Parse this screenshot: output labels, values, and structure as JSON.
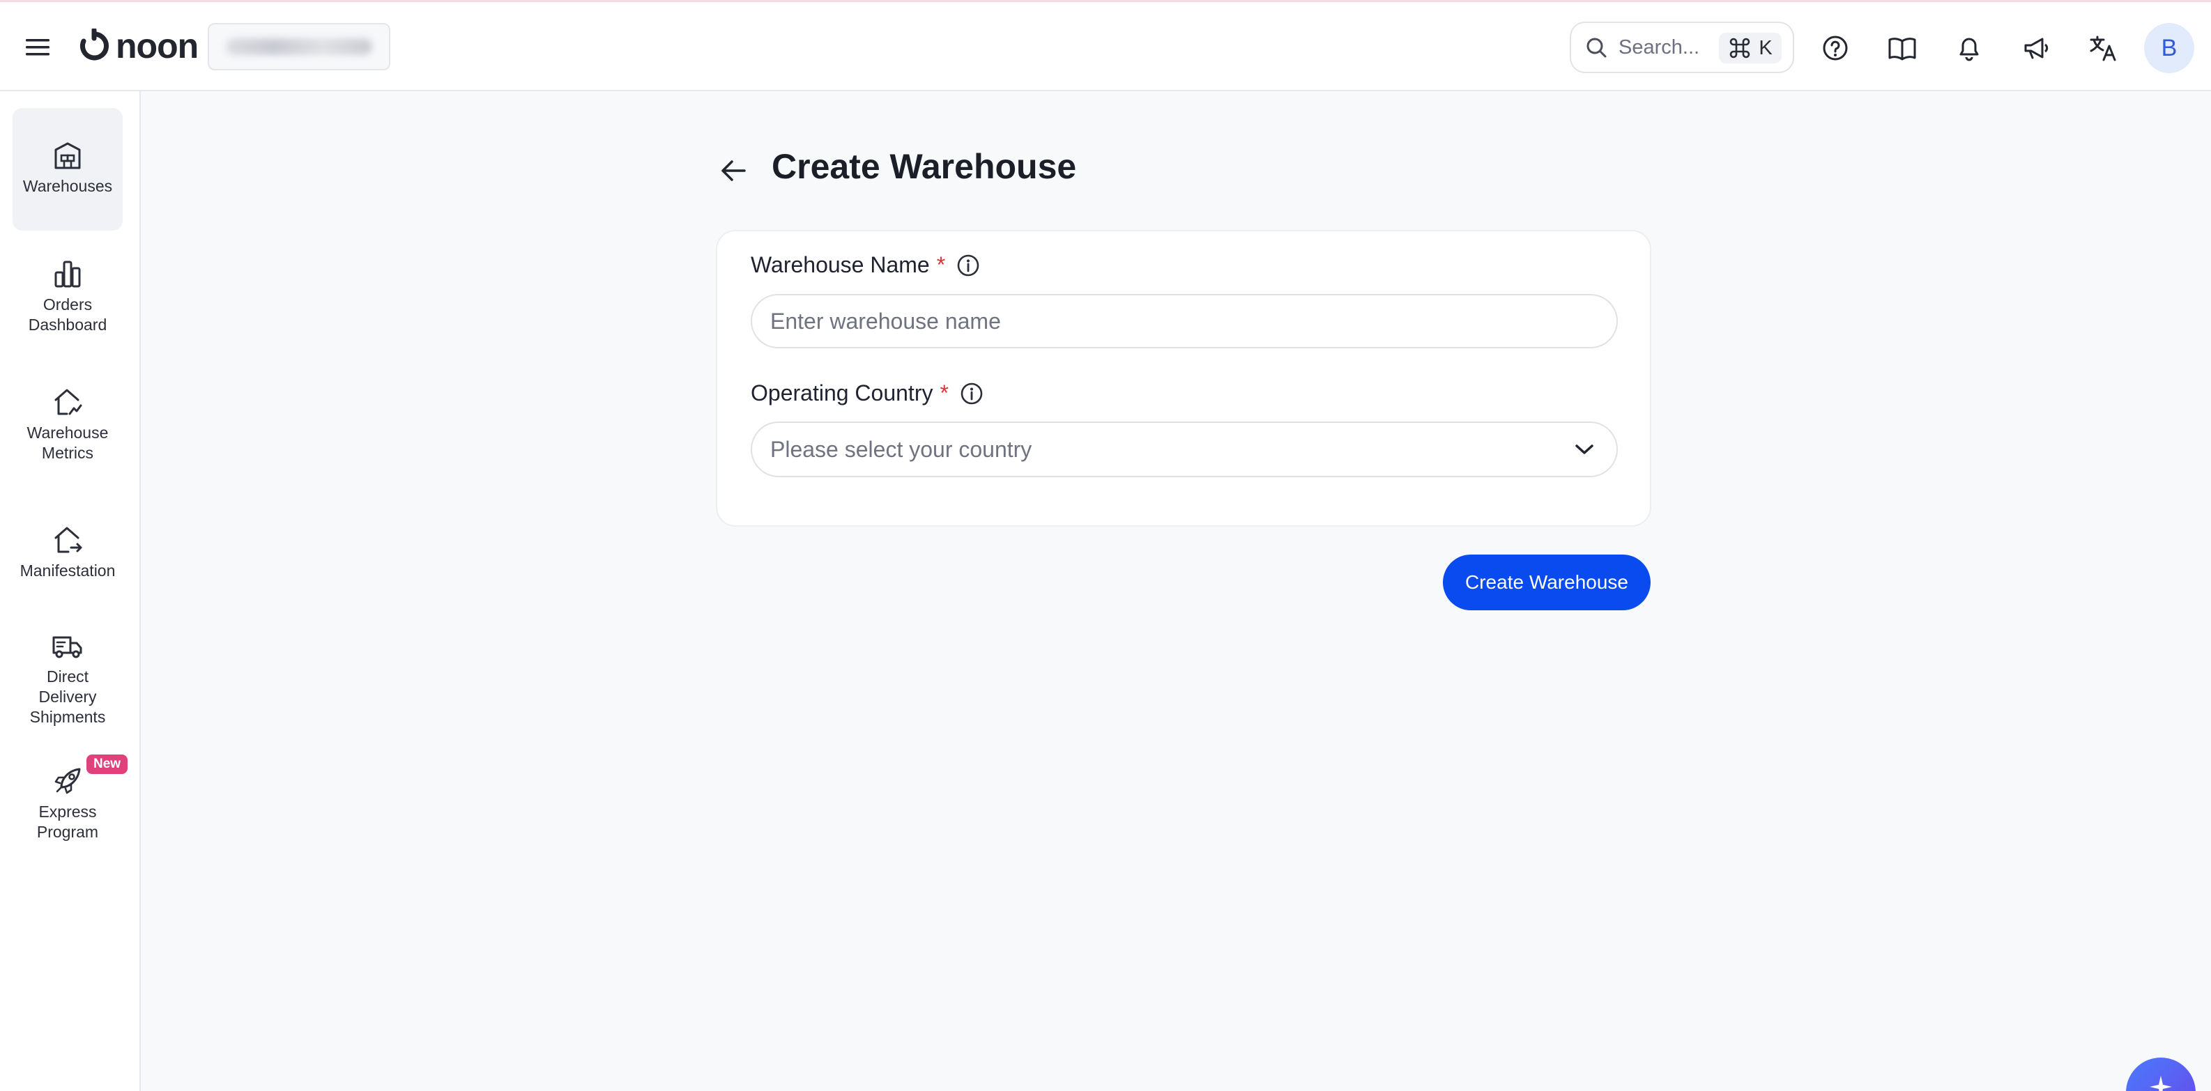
{
  "topbar": {
    "brand": "noon",
    "search_placeholder": "Search...",
    "shortcut_key": "K",
    "avatar_initial": "B"
  },
  "sidebar": {
    "items": [
      {
        "label": "Warehouses",
        "icon": "warehouse-icon",
        "active": true
      },
      {
        "label": "Orders\nDashboard",
        "icon": "bar-chart-icon"
      },
      {
        "label": "Warehouse\nMetrics",
        "icon": "home-metrics-icon"
      },
      {
        "label": "Manifestation",
        "icon": "home-export-icon"
      },
      {
        "label": "Direct\nDelivery\nShipments",
        "icon": "truck-icon"
      },
      {
        "label": "Express\nProgram",
        "icon": "rocket-icon",
        "badge": "New"
      }
    ]
  },
  "page": {
    "title": "Create Warehouse"
  },
  "form": {
    "name_label": "Warehouse Name",
    "name_placeholder": "Enter warehouse name",
    "country_label": "Operating Country",
    "country_placeholder": "Please select your country",
    "required_mark": "*",
    "submit_label": "Create Warehouse"
  },
  "colors": {
    "primary": "#0a4bf0",
    "required": "#e0313d",
    "badge": "#e0417b"
  }
}
